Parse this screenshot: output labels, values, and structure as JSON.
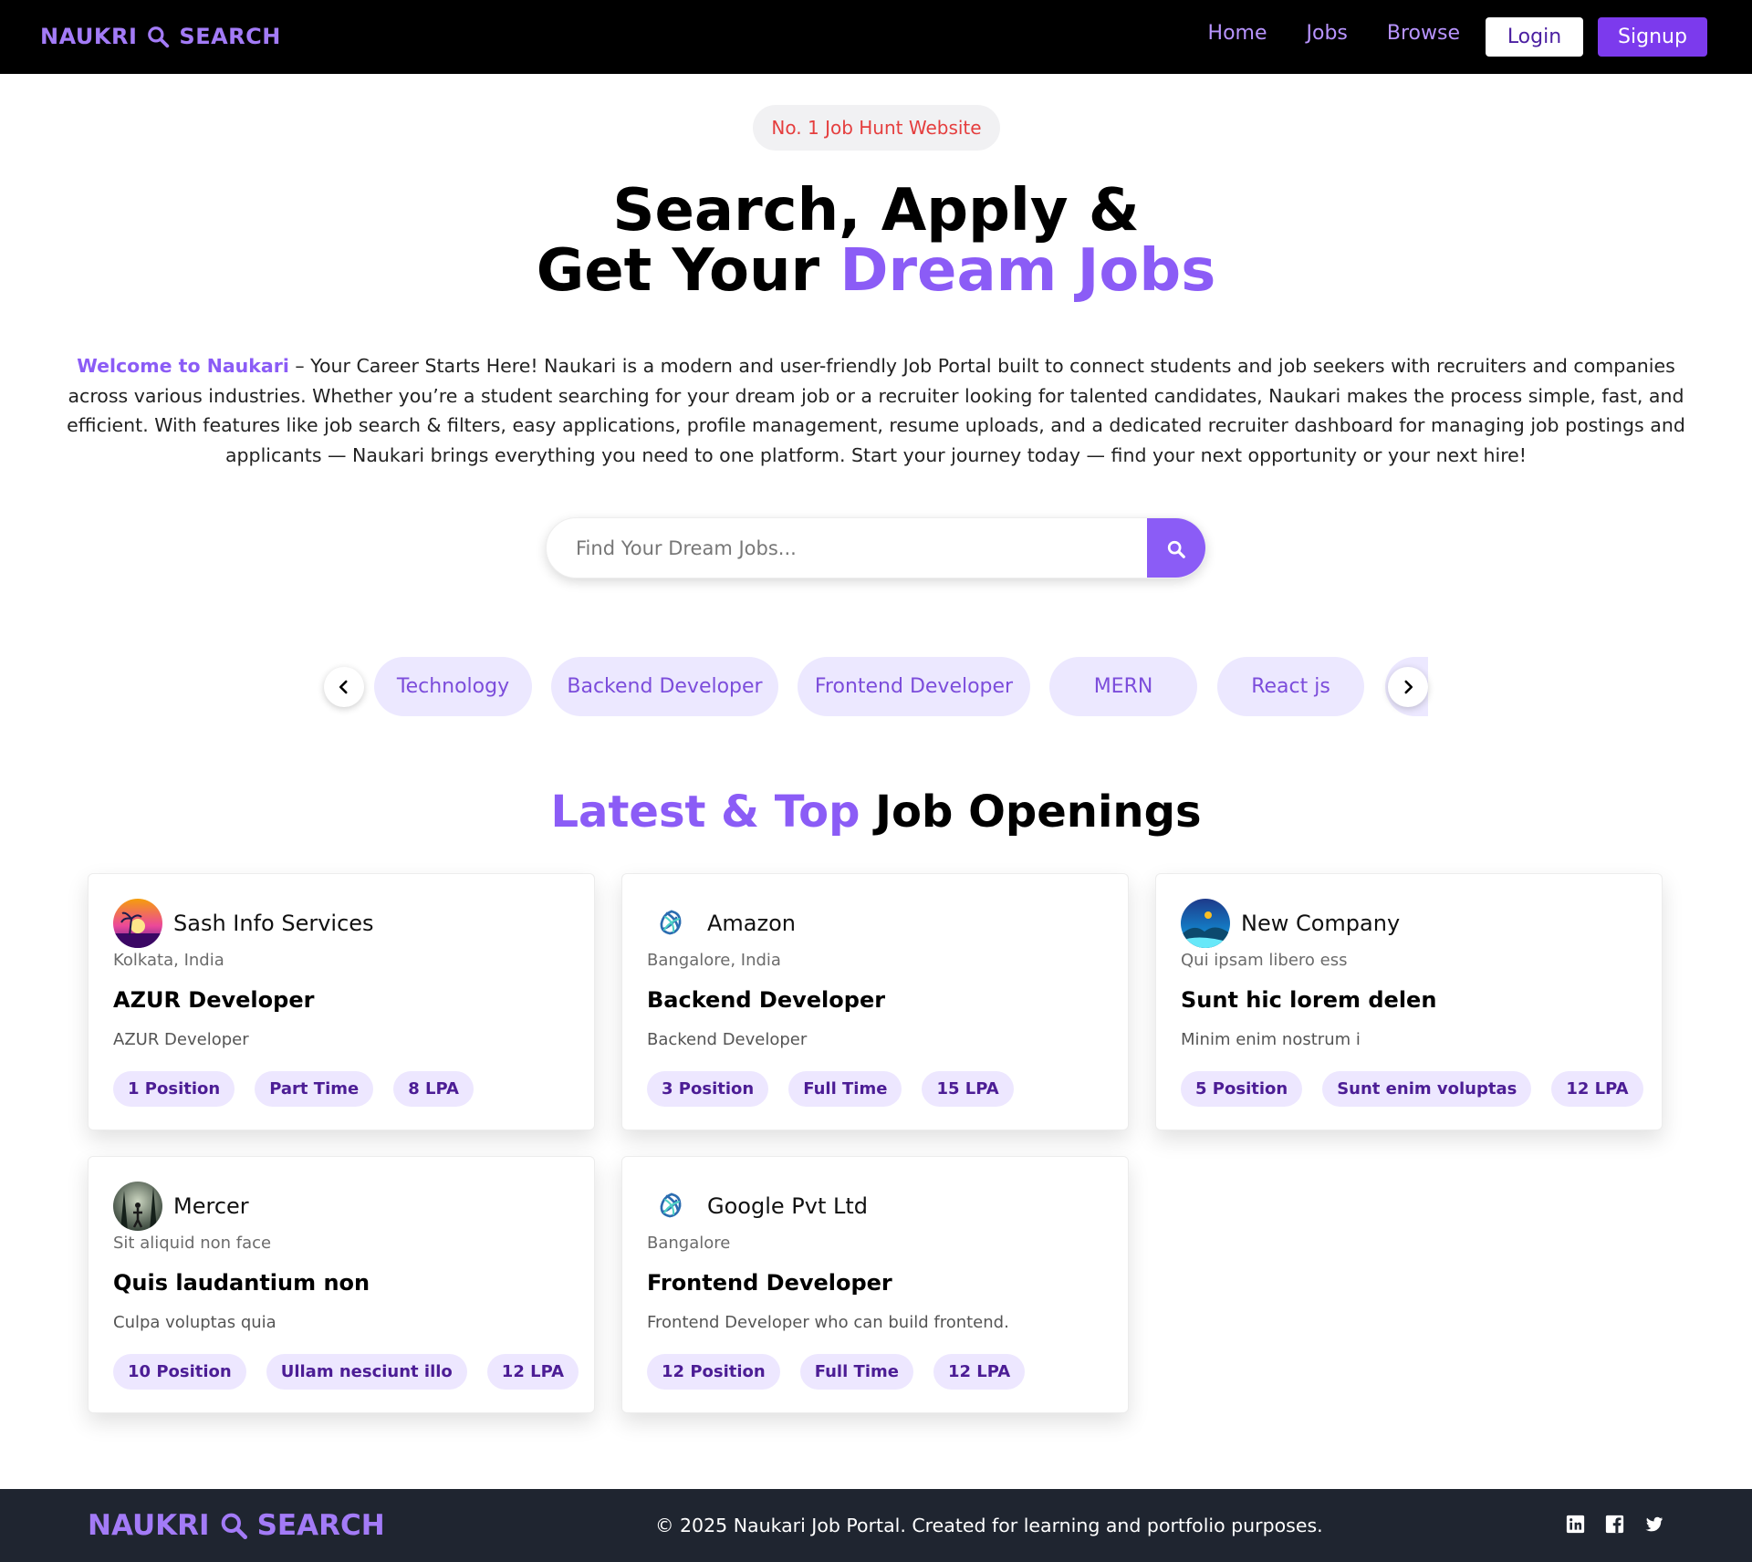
{
  "navbar": {
    "brand_left": "NAUKRI",
    "brand_right": "SEARCH",
    "links": [
      "Home",
      "Jobs",
      "Browse"
    ],
    "login_label": "Login",
    "signup_label": "Signup"
  },
  "hero": {
    "badge": "No. 1 Job Hunt Website",
    "title_line1": "Search, Apply &",
    "title_line2_plain": "Get Your ",
    "title_line2_accent": "Dream Jobs",
    "intro_highlight": "Welcome to Naukari",
    "intro_text": " – Your Career Starts Here! Naukari is a modern and user-friendly Job Portal built to connect students and job seekers with recruiters and companies across various industries. Whether you’re a student searching for your dream job or a recruiter looking for talented candidates, Naukari makes the process simple, fast, and efficient. With features like job search & filters, easy applications, profile management, resume uploads, and a dedicated recruiter dashboard for managing job postings and applicants — Naukari brings everything you need to one platform. Start your journey today — find your next opportunity or your next hire!"
  },
  "search": {
    "placeholder": "Find Your Dream Jobs...",
    "value": ""
  },
  "categories": [
    "Technology",
    "Backend Developer",
    "Frontend Developer",
    "MERN",
    "React js"
  ],
  "section": {
    "title_accent": "Latest & Top",
    "title_plain": " Job Openings"
  },
  "jobs": [
    {
      "company": "Sash Info Services",
      "location": "Kolkata, India",
      "title": "AZUR Developer",
      "description": "AZUR Developer",
      "positions": "1 Position",
      "type": "Part Time",
      "salary": "8 LPA",
      "logo": "sunset-palm-logo"
    },
    {
      "company": "Amazon",
      "location": "Bangalore, India",
      "title": "Backend Developer",
      "description": "Backend Developer",
      "positions": "3 Position",
      "type": "Full Time",
      "salary": "15 LPA",
      "logo": "spiral-logo"
    },
    {
      "company": "New Company",
      "location": "Qui ipsam libero ess",
      "title": "Sunt hic lorem delen",
      "description": "Minim enim nostrum i",
      "positions": "5 Position",
      "type": "Sunt enim voluptas",
      "salary": "12 LPA",
      "logo": "night-landscape-logo"
    },
    {
      "company": "Mercer",
      "location": "Sit aliquid non face",
      "title": "Quis laudantium non",
      "description": "Culpa voluptas quia",
      "positions": "10 Position",
      "type": "Ullam nesciunt illo",
      "salary": "12 LPA",
      "logo": "forest-figure-logo"
    },
    {
      "company": "Google Pvt Ltd",
      "location": "Bangalore",
      "title": "Frontend Developer",
      "description": "Frontend Developer who can build frontend.",
      "positions": "12 Position",
      "type": "Full Time",
      "salary": "12 LPA",
      "logo": "spiral-logo"
    }
  ],
  "footer": {
    "brand_left": "NAUKRI",
    "brand_right": "SEARCH",
    "copyright": "© 2025 Naukari Job Portal. Created for learning and portfolio purposes.",
    "socials": [
      "linkedin-icon",
      "facebook-icon",
      "twitter-icon"
    ]
  },
  "colors": {
    "accent": "#8b5cf6",
    "brand": "#a37bf7",
    "signup": "#7c3aed",
    "badge_text": "#e53e3e",
    "footer_bg": "#1f2530",
    "tag_bg": "#ede7ff"
  }
}
